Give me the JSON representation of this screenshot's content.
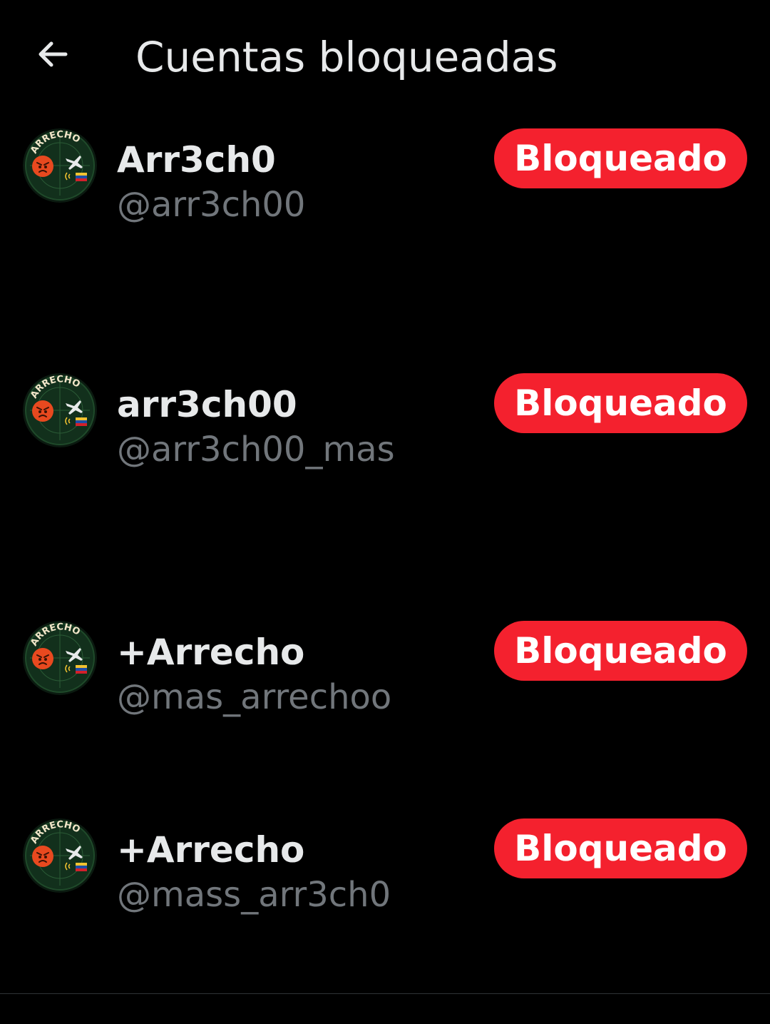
{
  "header": {
    "title": "Cuentas bloqueadas",
    "back_icon": "arrow-left-icon"
  },
  "colors": {
    "background": "#000000",
    "button_red": "#f4212e",
    "handle_gray": "#71767b",
    "text": "#e7e9ea"
  },
  "accounts": [
    {
      "name": "Arr3ch0",
      "handle": "@arr3ch00",
      "button_label": "Bloqueado",
      "avatar_text": "ARRECHO"
    },
    {
      "name": "arr3ch00",
      "handle": "@arr3ch00_mas",
      "button_label": "Bloqueado",
      "avatar_text": "ARRECHO"
    },
    {
      "name": "+Arrecho",
      "handle": "@mas_arrechoo",
      "button_label": "Bloqueado",
      "avatar_text": "ARRECHO"
    },
    {
      "name": "+Arrecho",
      "handle": "@mass_arr3ch0",
      "button_label": "Bloqueado",
      "avatar_text": "ARRECHO"
    }
  ]
}
